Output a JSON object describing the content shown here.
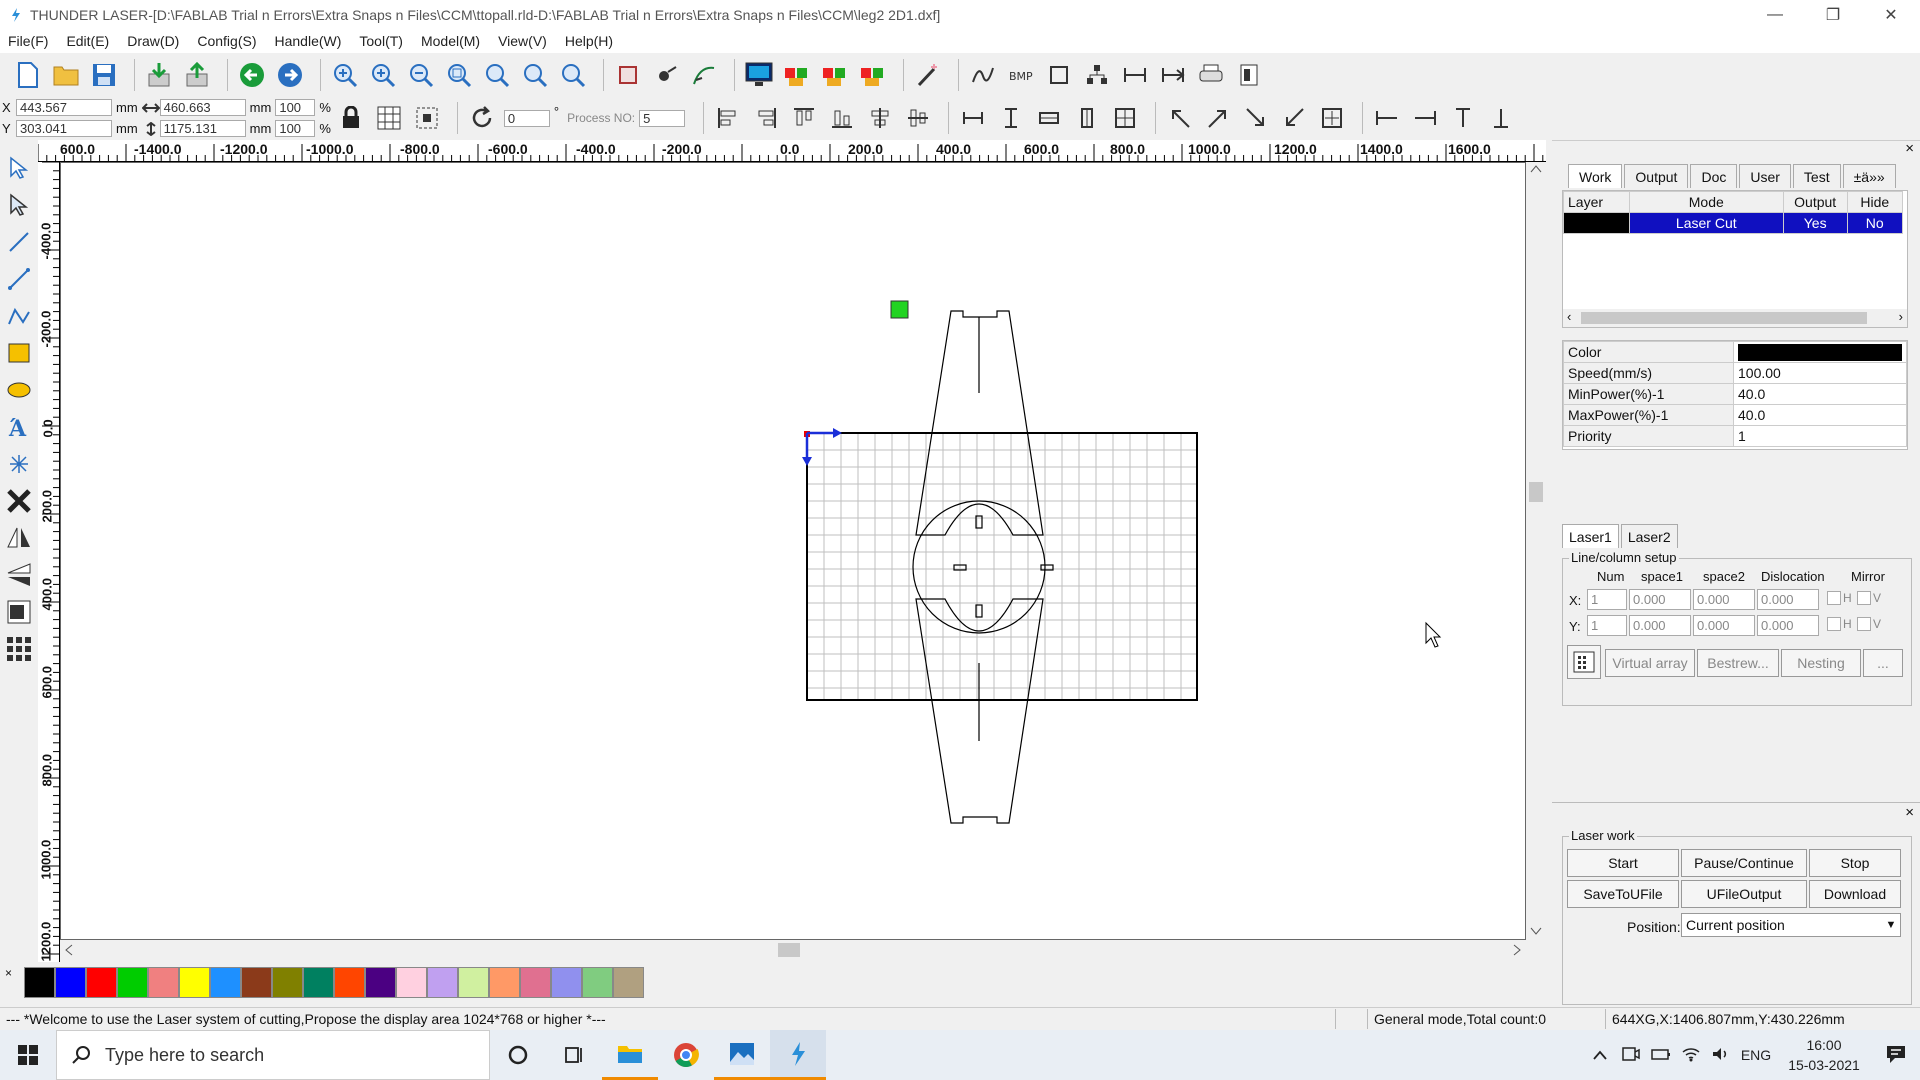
{
  "window": {
    "title": "THUNDER LASER-[D:\\FABLAB Trial n Errors\\Extra Snaps n Files\\CCM\\ttopall.rld-D:\\FABLAB Trial n Errors\\Extra Snaps n Files\\CCM\\leg2 2D1.dxf]",
    "minimize": "—",
    "restore": "❐",
    "close": "✕"
  },
  "menu": [
    "File(F)",
    "Edit(E)",
    "Draw(D)",
    "Config(S)",
    "Handle(W)",
    "Tool(T)",
    "Model(M)",
    "View(V)",
    "Help(H)"
  ],
  "coords": {
    "x_label": "X",
    "y_label": "Y",
    "x_value": "443.567",
    "y_value": "303.041",
    "unit": "mm",
    "width_value": "460.663",
    "height_value": "1175.131",
    "scale_x": "100",
    "scale_y": "100",
    "percent": "%",
    "rotate_value": "0",
    "degree": "°",
    "process_label": "Process NO:",
    "process_value": "5"
  },
  "ruler": {
    "h_ticks": [
      "600.0",
      "-1400.0",
      "-1200.0",
      "-1000.0",
      "-800.0",
      "-600.0",
      "-400.0",
      "-200.0",
      "0.0",
      "200.0",
      "400.0",
      "600.0",
      "800.0",
      "1000.0",
      "1200.0",
      "1400.0",
      "1600.0"
    ],
    "v_ticks": [
      "-400.0",
      "-200.0",
      "0.0",
      "200.0",
      "400.0",
      "600.0",
      "800.0",
      "1000.0",
      "1200.0"
    ]
  },
  "palette": [
    "#000000",
    "#0000ff",
    "#ff0000",
    "#00cc00",
    "#f08080",
    "#ffff00",
    "#1e90ff",
    "#8b3a1a",
    "#808000",
    "#008060",
    "#ff4500",
    "#4b0082",
    "#ffd0e0",
    "#c0a0f0",
    "#d0f0a0",
    "#ff9966",
    "#e07090",
    "#9090ee",
    "#80cc80",
    "#b0a080"
  ],
  "status": {
    "welcome": "--- *Welcome to use the Laser system of cutting,Propose the display area 1024*768 or higher *---",
    "mode": "General mode,Total count:0",
    "position": "644XG,X:1406.807mm,Y:430.226mm"
  },
  "panel": {
    "tabs": [
      "Work",
      "Output",
      "Doc",
      "User",
      "Test",
      "±ä»»"
    ],
    "layer_headers": [
      "Layer",
      "Mode",
      "Output",
      "Hide"
    ],
    "layer_row": {
      "color": "#000000",
      "mode": "Laser Cut",
      "output": "Yes",
      "hide": "No"
    },
    "properties": [
      {
        "label": "Color",
        "value": ""
      },
      {
        "label": "Speed(mm/s)",
        "value": "100.00"
      },
      {
        "label": "MinPower(%)-1",
        "value": "40.0"
      },
      {
        "label": "MaxPower(%)-1",
        "value": "40.0"
      },
      {
        "label": "Priority",
        "value": "1"
      }
    ],
    "laser_tabs": [
      "Laser1",
      "Laser2"
    ],
    "array": {
      "group_label": "Line/column setup",
      "headers": [
        "Num",
        "space1",
        "space2",
        "Dislocation",
        "Mirror"
      ],
      "x_label": "X:",
      "y_label": "Y:",
      "x_values": [
        "1",
        "0.000",
        "0.000",
        "0.000"
      ],
      "y_values": [
        "1",
        "0.000",
        "0.000",
        "0.000"
      ],
      "mirror_h": "H",
      "mirror_v": "V",
      "buttons": [
        "Virtual array",
        "Bestrew...",
        "Nesting",
        "..."
      ]
    },
    "laser_work": {
      "group_label": "Laser work",
      "buttons": [
        "Start",
        "Pause/Continue",
        "Stop",
        "SaveToUFile",
        "UFileOutput",
        "Download"
      ],
      "position_label": "Position:",
      "position_value": "Current position"
    },
    "close": "×"
  },
  "taskbar": {
    "search_placeholder": "Type here to search",
    "language": "ENG",
    "time": "16:00",
    "date": "15-03-2021"
  }
}
